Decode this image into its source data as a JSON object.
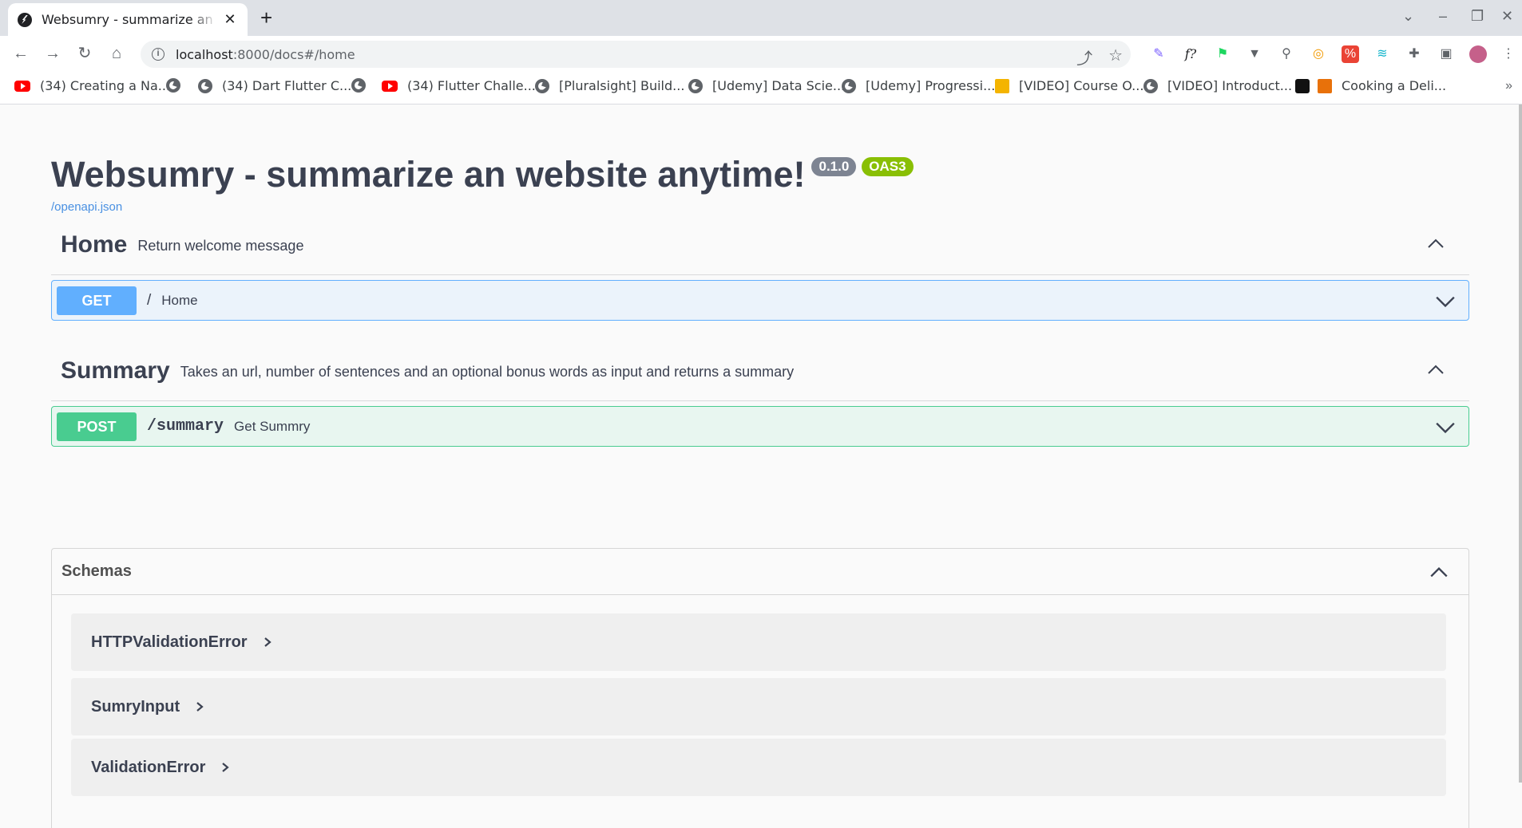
{
  "browser": {
    "tab_title": "Websumry - summarize an website anytime!",
    "tab_close": "✕",
    "new_tab": "+",
    "url_host": "localhost",
    "url_rest": ":8000/docs#/home",
    "bookmarks": [
      {
        "label": "(34) Creating a Na...",
        "icon": "youtube-icon"
      },
      {
        "label": "",
        "icon": "globe-icon"
      },
      {
        "label": "(34) Dart Flutter C...",
        "icon": "globe-icon"
      },
      {
        "label": "",
        "icon": "globe-icon"
      },
      {
        "label": "(34) Flutter Challe...",
        "icon": "youtube-icon"
      },
      {
        "label": "[Pluralsight] Build...",
        "icon": "globe-icon"
      },
      {
        "label": "[Udemy] Data Scie...",
        "icon": "globe-icon"
      },
      {
        "label": "[Udemy] Progressi...",
        "icon": "globe-icon"
      },
      {
        "label": "[VIDEO] Course O...",
        "icon": "pin-icon"
      },
      {
        "label": "[VIDEO] Introduct...",
        "icon": "globe-icon"
      },
      {
        "label": "Cooking a Deli...",
        "icon": "cup-icon"
      }
    ],
    "bookmarks_more": "»"
  },
  "docs": {
    "title": "Websumry - summarize an website anytime!",
    "version": "0.1.0",
    "oas_badge": "OAS3",
    "spec_link": "/openapi.json",
    "tags": [
      {
        "name": "Home",
        "description": "Return welcome message",
        "operation": {
          "method": "GET",
          "path": "/",
          "summary": "Home"
        }
      },
      {
        "name": "Summary",
        "description": "Takes an url, number of sentences and an optional bonus words as input and returns a summary",
        "operation": {
          "method": "POST",
          "path": "/summary",
          "summary": "Get Summry"
        }
      }
    ],
    "schemas": {
      "title": "Schemas",
      "models": [
        "HTTPValidationError",
        "SumryInput",
        "ValidationError"
      ]
    }
  },
  "colors": {
    "get": "#61affe",
    "post": "#49cc90",
    "version_badge": "#7d8492",
    "oas_badge": "#89bf04",
    "link": "#4990e2"
  }
}
